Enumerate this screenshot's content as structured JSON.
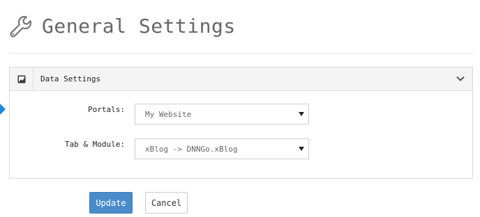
{
  "header": {
    "title": "General Settings",
    "icon": "wrench-icon"
  },
  "panel": {
    "title": "Data Settings",
    "icon": "image-icon",
    "collapse_icon": "chevron-down-icon"
  },
  "form": {
    "portals": {
      "label": "Portals:",
      "value": "My Website"
    },
    "tab_module": {
      "label": "Tab & Module:",
      "value": "xBlog -> DNNGo.xBlog"
    }
  },
  "actions": {
    "update_label": "Update",
    "cancel_label": "Cancel"
  },
  "colors": {
    "primary": "#4a8ccb",
    "marker": "#1e88e5"
  }
}
